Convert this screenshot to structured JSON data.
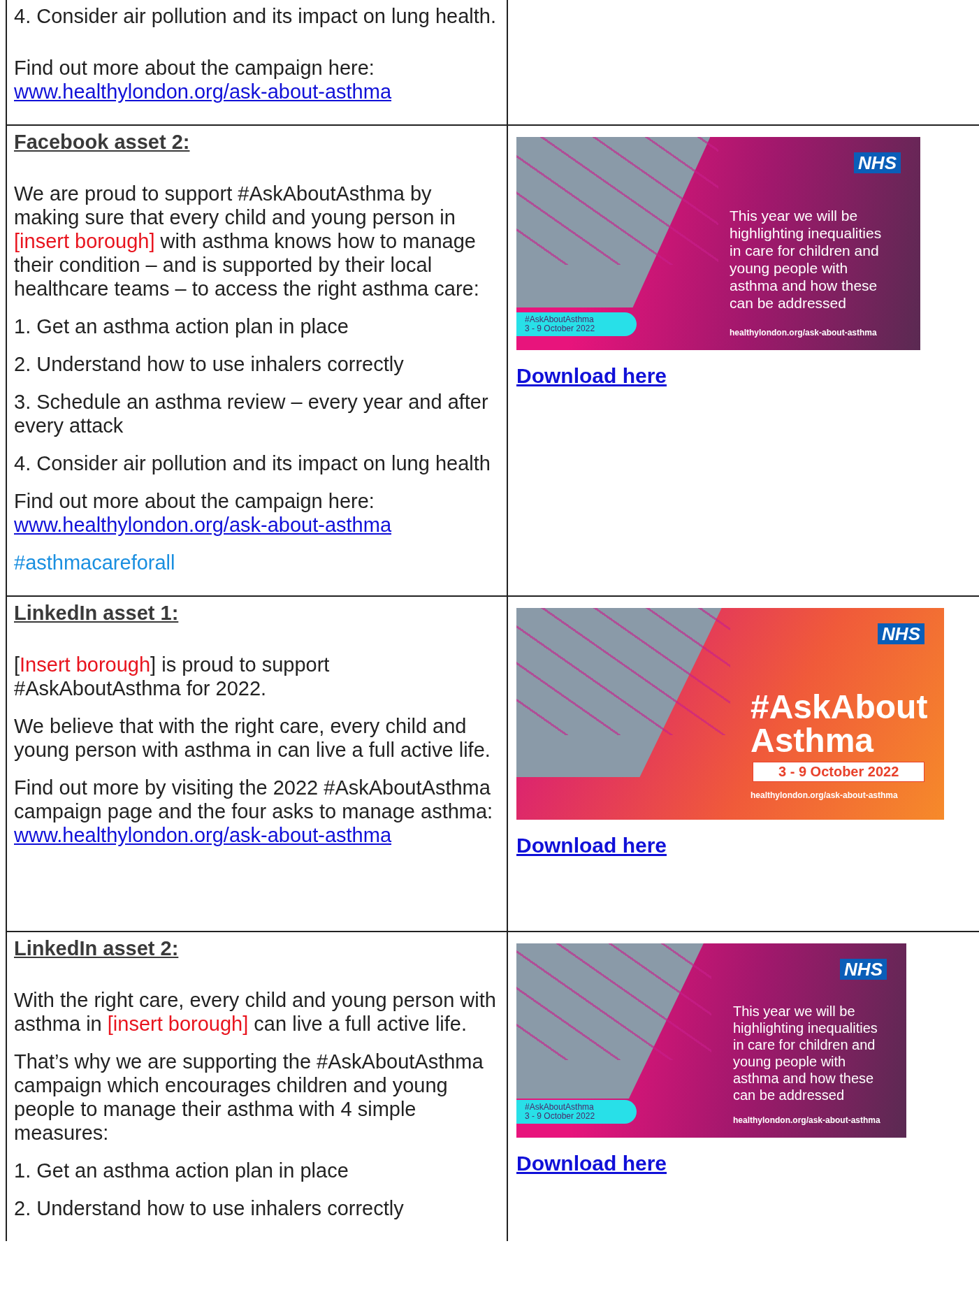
{
  "rows": [
    {
      "left": [
        {
          "kind": "paragraph",
          "segments": [
            {
              "kind": "plain",
              "text": "4. Consider air pollution and its impact on lung health."
            }
          ]
        },
        {
          "kind": "paragraph",
          "segments": [
            {
              "kind": "plain",
              "text": "Find out more about the campaign here: "
            },
            {
              "kind": "link",
              "text": "www.healthylondon.org/ask-about-asthma"
            }
          ]
        }
      ],
      "right": null
    },
    {
      "left": [
        {
          "kind": "heading",
          "segments": [
            {
              "kind": "plain",
              "text": "Facebook asset 2:"
            }
          ]
        },
        {
          "kind": "paragraph",
          "segments": [
            {
              "kind": "plain",
              "text": "We are proud to support #AskAboutAsthma by making sure that every child and young person in "
            },
            {
              "kind": "placeholder",
              "text": "[insert borough]"
            },
            {
              "kind": "plain",
              "text": " with asthma knows how to manage their condition – and is supported by their local healthcare teams – to access the right asthma care:"
            }
          ]
        },
        {
          "kind": "paragraph",
          "segments": [
            {
              "kind": "plain",
              "text": "1. Get an asthma action plan in place"
            }
          ]
        },
        {
          "kind": "paragraph",
          "segments": [
            {
              "kind": "plain",
              "text": "2. Understand how to use inhalers correctly"
            }
          ]
        },
        {
          "kind": "paragraph",
          "segments": [
            {
              "kind": "plain",
              "text": "3. Schedule an asthma review – every year and after every attack"
            }
          ]
        },
        {
          "kind": "paragraph",
          "segments": [
            {
              "kind": "plain",
              "text": "4. Consider air pollution and its impact on lung health"
            }
          ]
        },
        {
          "kind": "paragraph",
          "segments": [
            {
              "kind": "plain",
              "text": "Find out more about the campaign here: "
            },
            {
              "kind": "link",
              "text": "www.healthylondon.org/ask-about-asthma"
            }
          ]
        },
        {
          "kind": "paragraph",
          "segments": [
            {
              "kind": "hashtag",
              "text": "#asthmacareforall"
            }
          ]
        }
      ],
      "right": {
        "banner": {
          "kind": "info",
          "logo": "NHS",
          "lines": [
            "This year we will be",
            "highlighting inequalities",
            "in care for children and",
            "young people with",
            "asthma and how these",
            "can be addressed"
          ],
          "hashtag": "#AskAboutAsthma",
          "dates": "3 - 9 October 2022",
          "url": "healthylondon.org/ask-about-asthma"
        },
        "download": "Download here"
      }
    },
    {
      "left": [
        {
          "kind": "heading",
          "segments": [
            {
              "kind": "plain",
              "text": "LinkedIn asset 1:"
            }
          ]
        },
        {
          "kind": "paragraph",
          "segments": [
            {
              "kind": "plain",
              "text": "["
            },
            {
              "kind": "placeholder",
              "text": "Insert borough"
            },
            {
              "kind": "plain",
              "text": "] is proud to support #AskAboutAsthma for 2022."
            }
          ]
        },
        {
          "kind": "paragraph",
          "segments": [
            {
              "kind": "plain",
              "text": "We believe that with the right care, every child and young person with asthma in can live a full active life."
            }
          ]
        },
        {
          "kind": "paragraph",
          "segments": [
            {
              "kind": "plain",
              "text": "Find out more by visiting the 2022 #AskAboutAsthma campaign page and the four asks to manage asthma: "
            },
            {
              "kind": "link",
              "text": "www.healthylondon.org/ask-about-asthma"
            }
          ]
        }
      ],
      "right": {
        "banner": {
          "kind": "title",
          "logo": "NHS",
          "lines": [
            "#AskAbout",
            "Asthma"
          ],
          "dates": "3 - 9 October 2022",
          "url": "healthylondon.org/ask-about-asthma"
        },
        "download": "Download here"
      }
    },
    {
      "left": [
        {
          "kind": "heading",
          "segments": [
            {
              "kind": "plain",
              "text": "LinkedIn asset 2:"
            }
          ]
        },
        {
          "kind": "paragraph",
          "segments": [
            {
              "kind": "plain",
              "text": "With the right care, every child and young person with asthma in "
            },
            {
              "kind": "placeholder",
              "text": "[insert borough]"
            },
            {
              "kind": "plain",
              "text": " can live a full active life."
            }
          ]
        },
        {
          "kind": "paragraph",
          "segments": [
            {
              "kind": "plain",
              "text": "That’s why we are supporting the #AskAboutAsthma campaign which encourages children and young people to manage their asthma with 4 simple measures:"
            }
          ]
        },
        {
          "kind": "paragraph",
          "segments": [
            {
              "kind": "plain",
              "text": "1. Get an asthma action plan in place"
            }
          ]
        },
        {
          "kind": "paragraph",
          "segments": [
            {
              "kind": "plain",
              "text": "2. Understand how to use inhalers correctly"
            }
          ]
        }
      ],
      "right": {
        "banner": {
          "kind": "info",
          "logo": "NHS",
          "lines": [
            "This year we will be",
            "highlighting inequalities",
            "in care for children and",
            "young people with",
            "asthma and how these",
            "can be addressed"
          ],
          "hashtag": "#AskAboutAsthma",
          "dates": "3 - 9 October 2022",
          "url": "healthylondon.org/ask-about-asthma"
        },
        "download": "Download here"
      }
    }
  ]
}
